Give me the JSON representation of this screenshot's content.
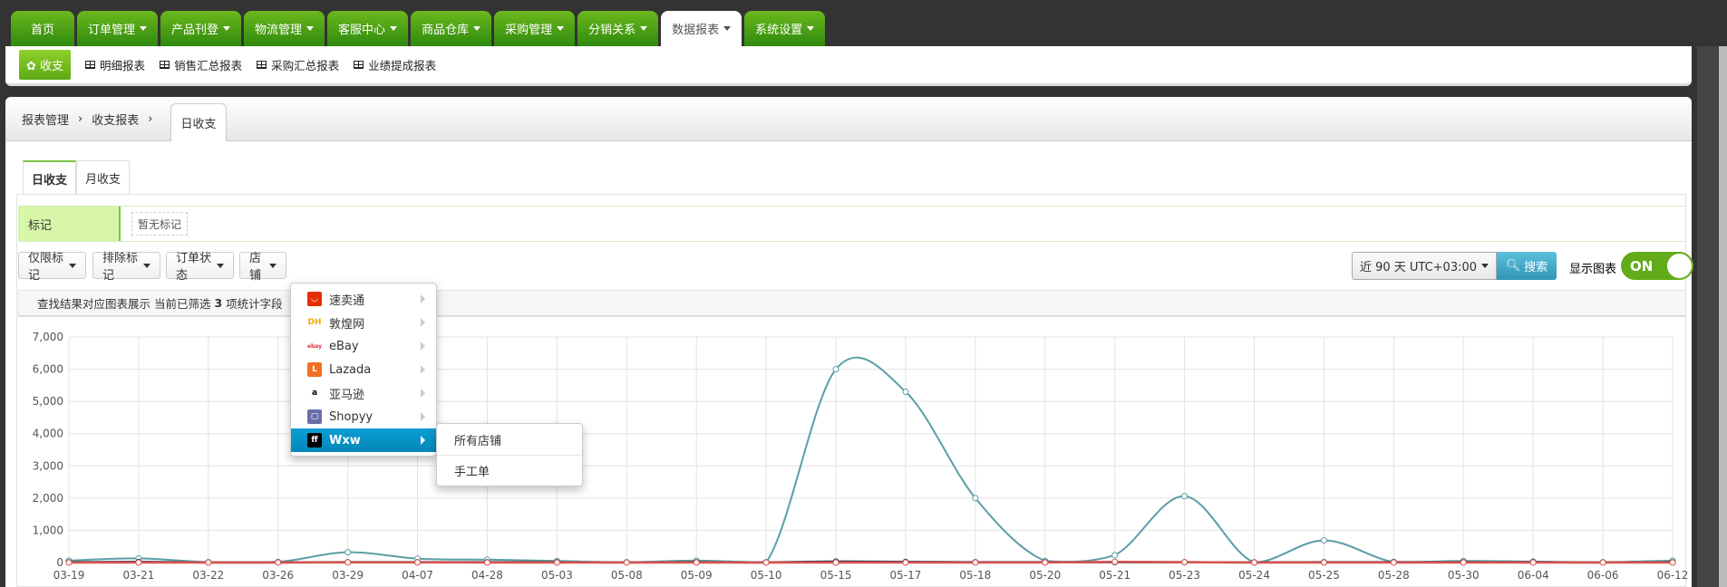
{
  "topnav": [
    {
      "label": "首页",
      "caret": false
    },
    {
      "label": "订单管理",
      "caret": true
    },
    {
      "label": "产品刊登",
      "caret": true
    },
    {
      "label": "物流管理",
      "caret": true
    },
    {
      "label": "客服中心",
      "caret": true
    },
    {
      "label": "商品仓库",
      "caret": true
    },
    {
      "label": "采购管理",
      "caret": true
    },
    {
      "label": "分销关系",
      "caret": true
    },
    {
      "label": "数据报表",
      "caret": true,
      "active": true
    },
    {
      "label": "系统设置",
      "caret": true
    }
  ],
  "subnav": {
    "active": "收支",
    "items": [
      "明细报表",
      "销售汇总报表",
      "采购汇总报表",
      "业绩提成报表"
    ]
  },
  "breadcrumb": {
    "items": [
      "报表管理",
      "收支报表"
    ],
    "current": "日收支"
  },
  "tabs": [
    "日收支",
    "月收支"
  ],
  "mark": {
    "label": "标记",
    "empty": "暂无标记"
  },
  "filters": [
    "仅限标记",
    "排除标记",
    "订单状态",
    "店铺"
  ],
  "date_range": "近 90 天 UTC+03:00",
  "search_label": "搜索",
  "show_chart_label": "显示图表",
  "toggle": "ON",
  "summary": {
    "prefix": "查找结果对应图表展示 当前已筛选",
    "count": "3",
    "suffix": "项统计字段"
  },
  "shop_menu": [
    {
      "label": "速卖通",
      "icon": "aliexpress-logo"
    },
    {
      "label": "敦煌网",
      "icon": "dhgate-logo"
    },
    {
      "label": "eBay",
      "icon": "ebay-logo"
    },
    {
      "label": "Lazada",
      "icon": "lazada-logo"
    },
    {
      "label": "亚马逊",
      "icon": "amazon-logo"
    },
    {
      "label": "Shopyy",
      "icon": "shopyy-logo"
    },
    {
      "label": "Wxw",
      "icon": "wxw-logo",
      "active": true
    }
  ],
  "shop_submenu": [
    "所有店铺",
    "手工单"
  ],
  "colors": {
    "green": "#4a9e16",
    "accent_blue": "#0a9ed3",
    "series": [
      "#5b9ea6",
      "#2c3e50",
      "#d9534f"
    ]
  },
  "chart_data": {
    "type": "line",
    "categories": [
      "03-19",
      "03-21",
      "03-22",
      "03-26",
      "03-29",
      "04-07",
      "04-28",
      "05-03",
      "05-08",
      "05-09",
      "05-10",
      "05-15",
      "05-17",
      "05-18",
      "05-20",
      "05-21",
      "05-23",
      "05-24",
      "05-25",
      "05-28",
      "05-30",
      "06-04",
      "06-06",
      "06-12"
    ],
    "ylim": [
      0,
      7000
    ],
    "yticks": [
      "0",
      "1,000",
      "2,000",
      "3,000",
      "4,000",
      "5,000",
      "6,000",
      "7,000"
    ],
    "grid": true,
    "series": [
      {
        "values": [
          60,
          130,
          10,
          20,
          320,
          120,
          90,
          50,
          10,
          60,
          10,
          6000,
          5300,
          2000,
          50,
          230,
          2060,
          10,
          690,
          20,
          50,
          30,
          10,
          60
        ]
      },
      {
        "values": [
          10,
          20,
          5,
          5,
          10,
          10,
          10,
          10,
          5,
          10,
          5,
          30,
          20,
          10,
          10,
          10,
          10,
          5,
          10,
          10,
          10,
          10,
          5,
          10
        ]
      },
      {
        "values": [
          0,
          0,
          0,
          0,
          5,
          5,
          0,
          0,
          0,
          0,
          0,
          0,
          0,
          0,
          0,
          20,
          10,
          0,
          0,
          0,
          0,
          0,
          0,
          0
        ]
      }
    ]
  }
}
